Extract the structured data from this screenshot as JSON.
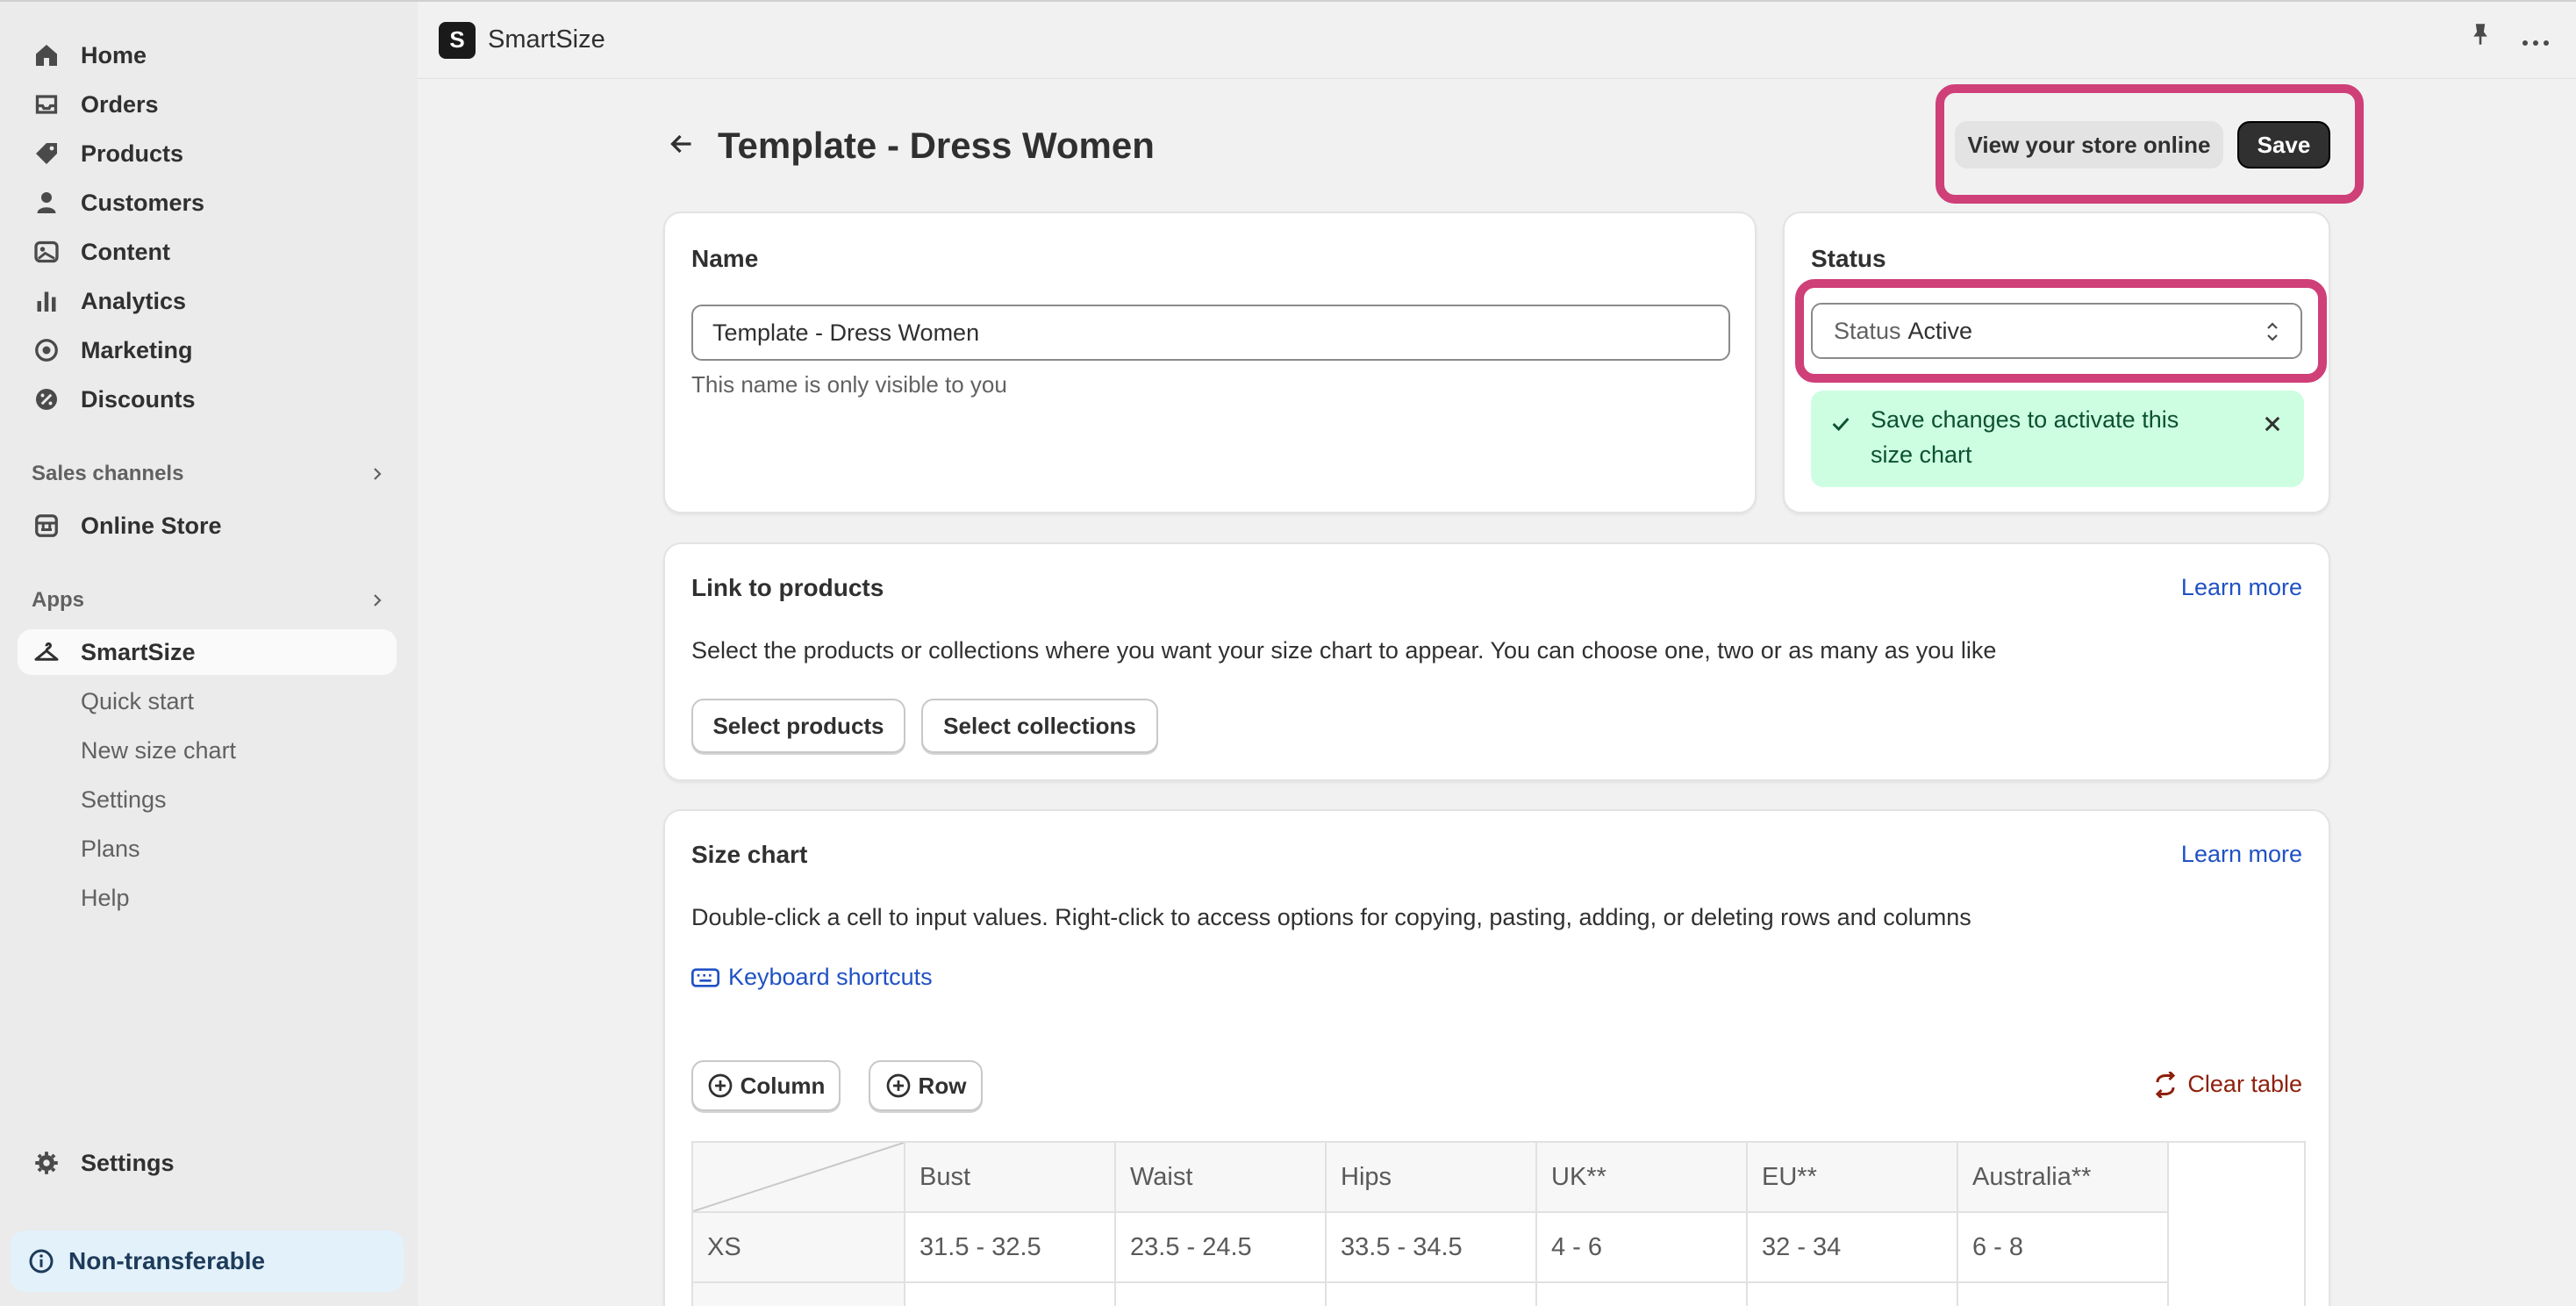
{
  "sidebar": {
    "nav": [
      {
        "label": "Home",
        "icon": "home-icon"
      },
      {
        "label": "Orders",
        "icon": "inbox-icon"
      },
      {
        "label": "Products",
        "icon": "tag-icon"
      },
      {
        "label": "Customers",
        "icon": "person-icon"
      },
      {
        "label": "Content",
        "icon": "image-icon"
      },
      {
        "label": "Analytics",
        "icon": "bar-chart-icon"
      },
      {
        "label": "Marketing",
        "icon": "target-icon"
      },
      {
        "label": "Discounts",
        "icon": "discount-icon"
      }
    ],
    "sales_channels_label": "Sales channels",
    "online_store_label": "Online Store",
    "apps_label": "Apps",
    "app_label": "SmartSize",
    "app_sub_items": [
      "Quick start",
      "New size chart",
      "Settings",
      "Plans",
      "Help"
    ],
    "settings_label": "Settings",
    "nontransferable_label": "Non-transferable"
  },
  "topbar": {
    "app_name": "SmartSize",
    "logo_letter": "S"
  },
  "header": {
    "title": "Template - Dress Women",
    "view_store_label": "View your store online",
    "save_label": "Save"
  },
  "name_card": {
    "title": "Name",
    "value": "Template - Dress Women",
    "helper": "This name is only visible to you"
  },
  "status_card": {
    "title": "Status",
    "select_label": "Status",
    "select_value": "Active",
    "banner_line1": "Save changes to activate this",
    "banner_line2": "size chart"
  },
  "link_card": {
    "title": "Link to products",
    "learn_more": "Learn more",
    "description": "Select the products or collections where you want your size chart to appear. You can choose one, two or as many as you like",
    "select_products": "Select products",
    "select_collections": "Select collections"
  },
  "size_card": {
    "title": "Size chart",
    "learn_more": "Learn more",
    "description": "Double-click a cell to input values. Right-click to access options for copying, pasting, adding, or deleting rows and columns",
    "keyboard_shortcuts": "Keyboard shortcuts",
    "add_column": "Column",
    "add_row": "Row",
    "clear_table": "Clear table",
    "table": {
      "headers": [
        "Bust",
        "Waist",
        "Hips",
        "UK**",
        "EU**",
        "Australia**"
      ],
      "rows": [
        {
          "label": "XS",
          "cells": [
            "31.5 - 32.5",
            "23.5 - 24.5",
            "33.5 - 34.5",
            "4 - 6",
            "32 - 34",
            "6 - 8"
          ]
        }
      ]
    }
  },
  "colors": {
    "highlight": "#cf3f78",
    "link": "#2051c4",
    "banner": "#cdfee1",
    "danger": "#8e1f0b"
  }
}
